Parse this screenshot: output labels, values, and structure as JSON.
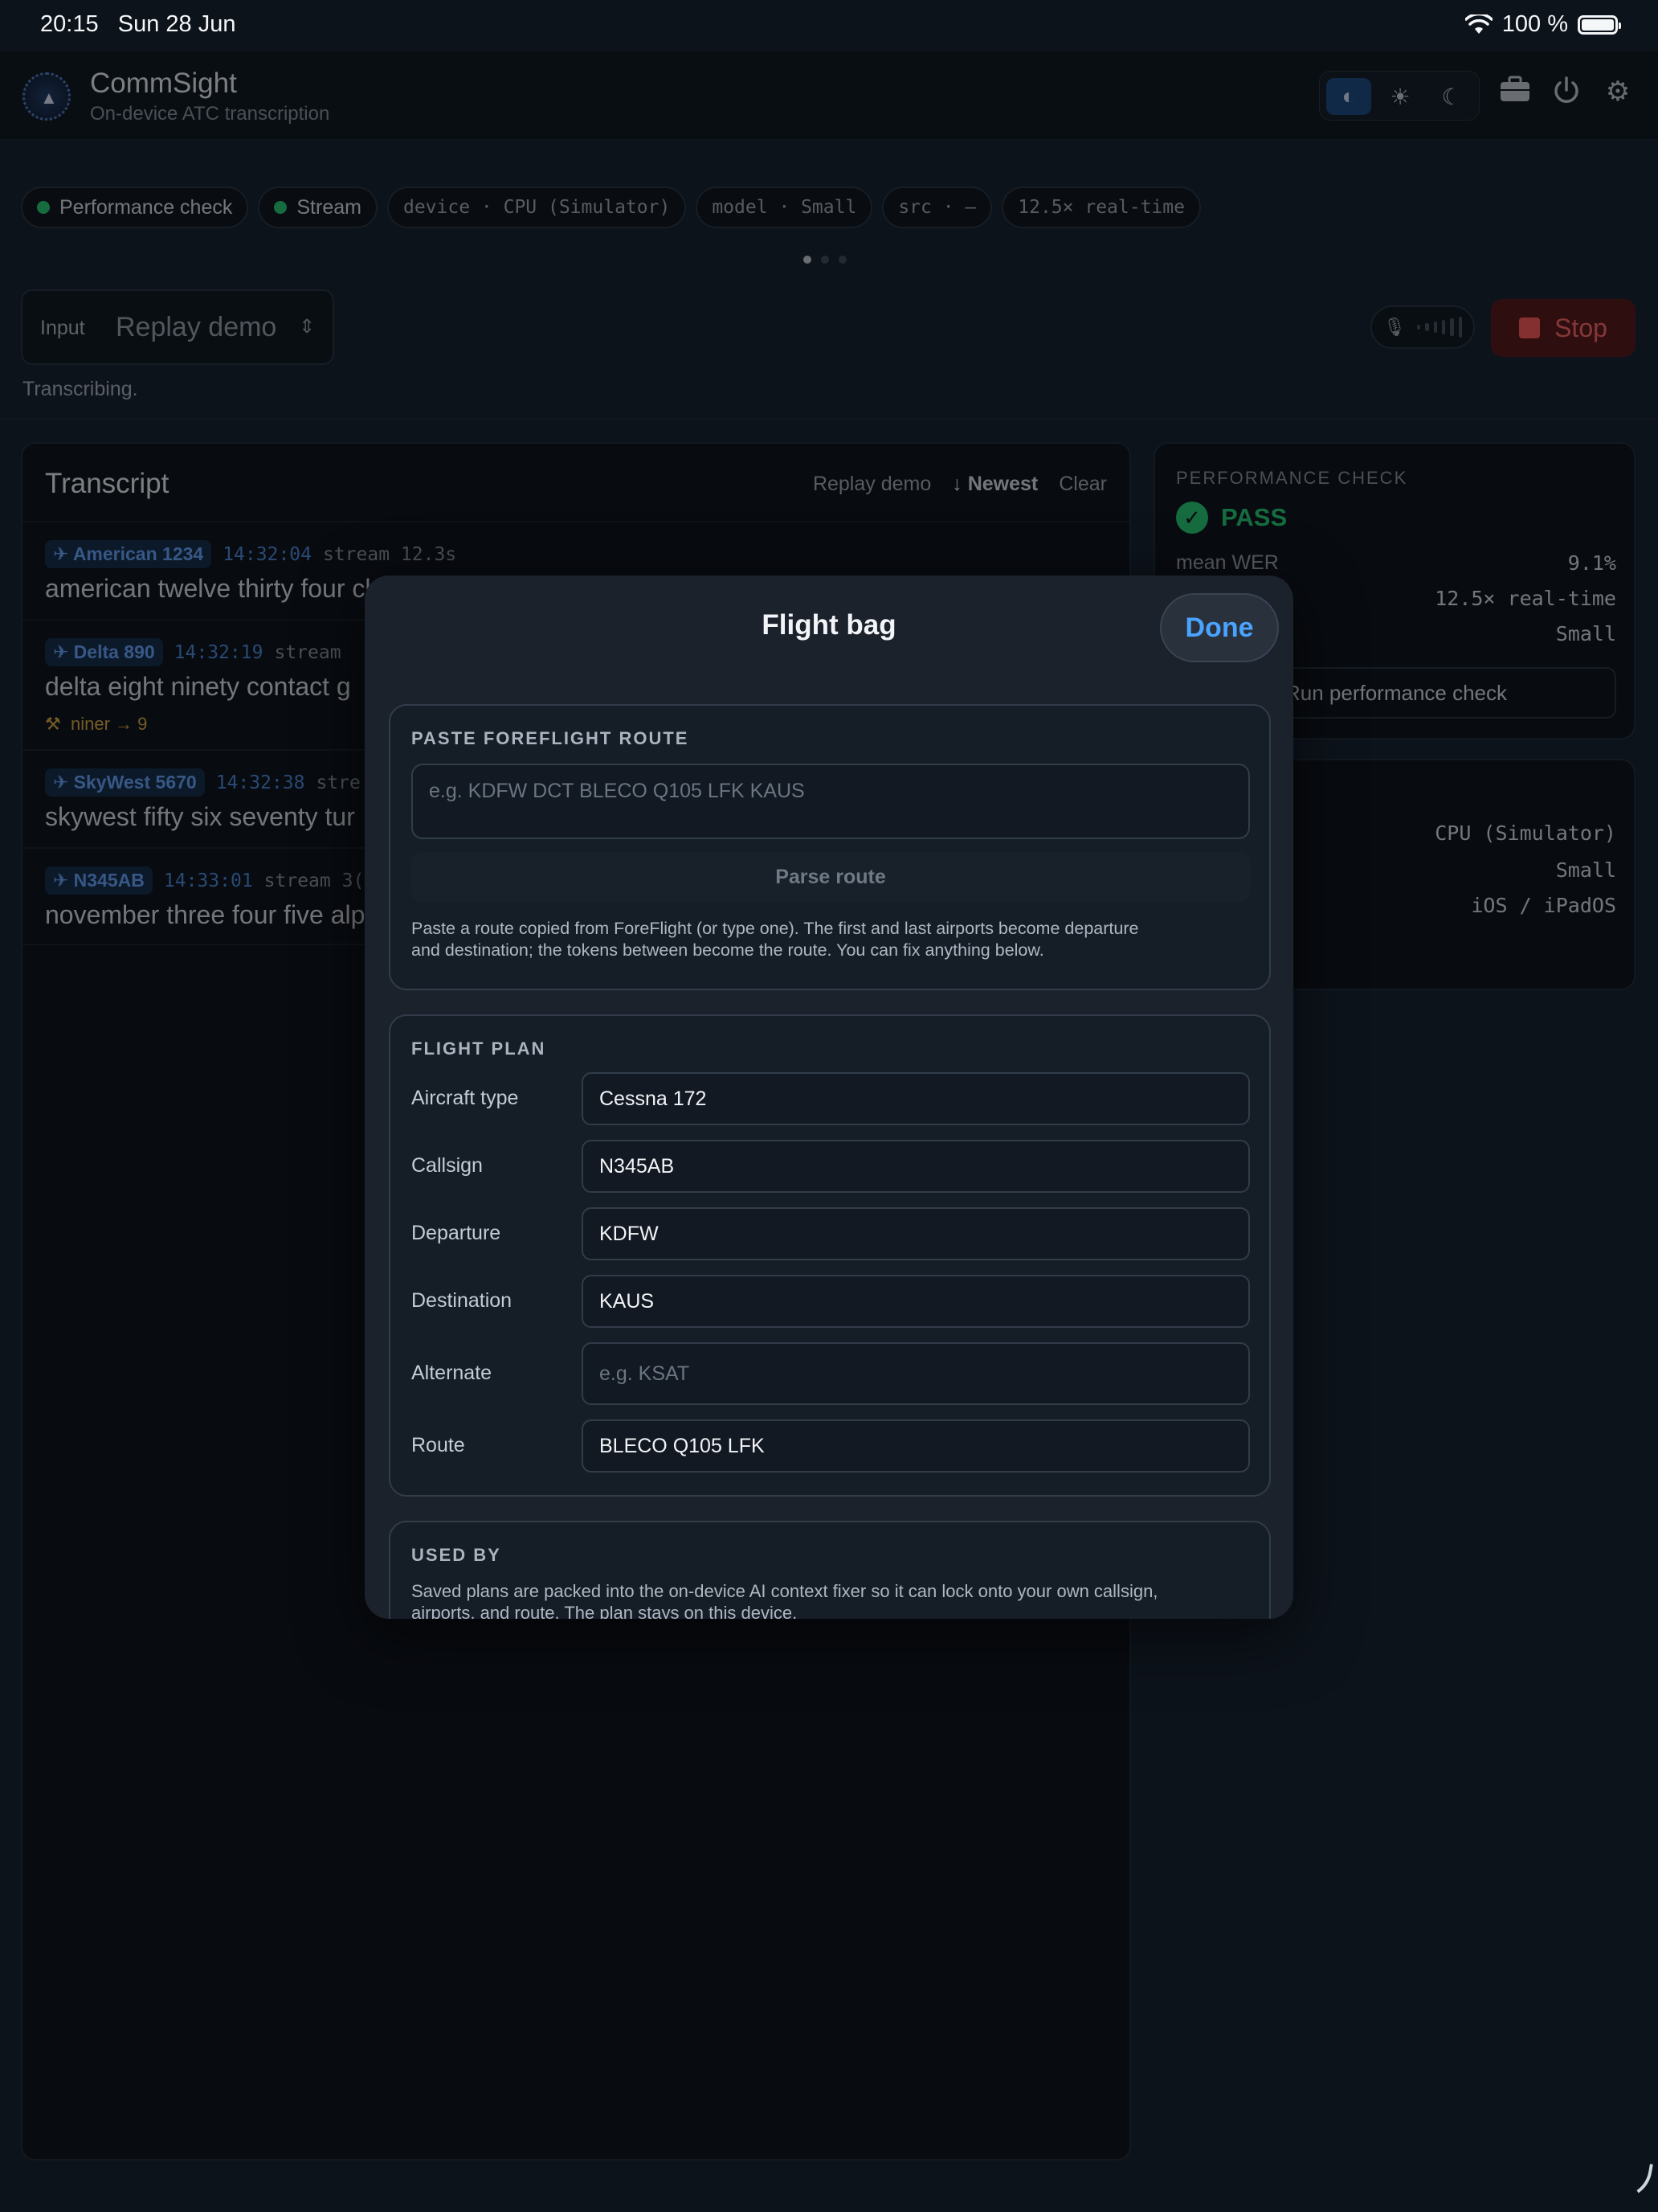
{
  "status_bar": {
    "time": "20:15",
    "date": "Sun 28 Jun",
    "battery": "100 %"
  },
  "app": {
    "title": "CommSight",
    "subtitle": "On-device ATC transcription",
    "theme_modes": [
      "auto-contrast-icon",
      "sun-icon",
      "moon-icon"
    ],
    "header_icons": [
      "briefcase-icon",
      "power-icon",
      "gear-icon"
    ]
  },
  "chips": {
    "perf": "Performance check",
    "stream": "Stream",
    "device": "device · CPU (Simulator)",
    "model": "model · Small",
    "src": "src · —",
    "rt": "12.5× real-time"
  },
  "input": {
    "label": "Input",
    "value": "Replay demo"
  },
  "stop_label": "Stop",
  "status_text": "Transcribing.",
  "transcript": {
    "title": "Transcript",
    "actions": {
      "replay": "Replay demo",
      "newest": "Newest",
      "clear": "Clear"
    },
    "rows": [
      {
        "callsign": "American 1234",
        "time": "14:32:04",
        "kind": "stream 12.3s",
        "text": "american twelve thirty four cl"
      },
      {
        "callsign": "Delta 890",
        "time": "14:32:19",
        "kind": "stream",
        "text": "delta eight ninety contact g",
        "fix": "niner → 9"
      },
      {
        "callsign": "SkyWest 5670",
        "time": "14:32:38",
        "kind": "stre",
        "text": "skywest fifty six seventy tur"
      },
      {
        "callsign": "N345AB",
        "time": "14:33:01",
        "kind": "stream 3(",
        "text": "november three four five alp"
      }
    ]
  },
  "perf_panel": {
    "heading": "PERFORMANCE CHECK",
    "result": "PASS",
    "mean_wer_label": "mean WER",
    "mean_wer": "9.1%",
    "rt": "12.5× real-time",
    "model": "Small",
    "run_label": "Run performance check"
  },
  "device_panel": {
    "device": "CPU (Simulator)",
    "model": "Small",
    "os": "iOS / iPadOS"
  },
  "modal": {
    "title": "Flight bag",
    "done": "Done",
    "paste": {
      "heading": "PASTE FOREFLIGHT ROUTE",
      "placeholder": "e.g. KDFW DCT BLECO Q105 LFK KAUS",
      "parse_label": "Parse route",
      "help_1": "Paste a route copied from ForeFlight (or type one). The first and last airports become departure",
      "help_2": "and destination; the tokens between become the route. You can fix anything below."
    },
    "plan": {
      "heading": "FLIGHT PLAN",
      "aircraft_label": "Aircraft type",
      "aircraft": "Cessna 172",
      "callsign_label": "Callsign",
      "callsign": "N345AB",
      "departure_label": "Departure",
      "departure": "KDFW",
      "destination_label": "Destination",
      "destination": "KAUS",
      "alternate_label": "Alternate",
      "alternate_placeholder": "e.g. KSAT",
      "route_label": "Route",
      "route": "BLECO Q105 LFK"
    },
    "used_by": {
      "heading": "USED BY",
      "text_1": "Saved plans are packed into the on-device AI context fixer so it can lock onto your own callsign,",
      "text_2": "airports, and route. The plan stays on this device."
    }
  }
}
